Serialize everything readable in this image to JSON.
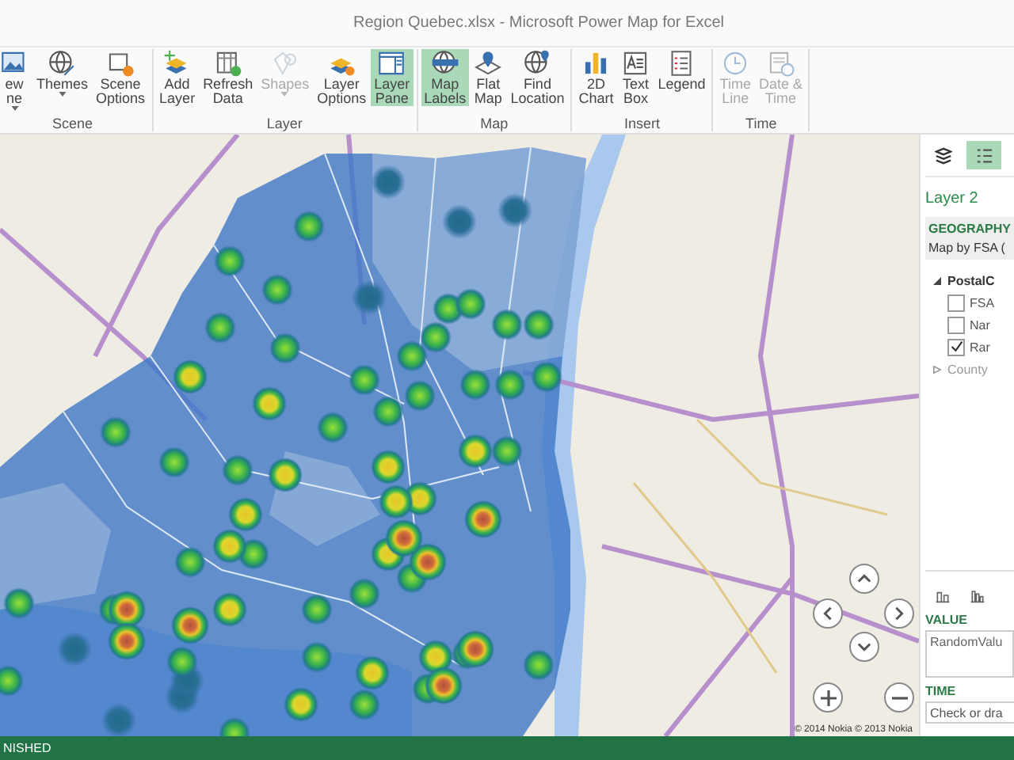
{
  "window": {
    "title": "Region Quebec.xlsx - Microsoft Power Map for Excel"
  },
  "ribbon": {
    "groups": [
      {
        "label": "Scene",
        "buttons": [
          {
            "label": "ew\nne",
            "dropdown": true,
            "selected": false,
            "disabled": false
          },
          {
            "label": "Themes",
            "dropdown": true,
            "selected": false,
            "disabled": false
          },
          {
            "label": "Scene\nOptions",
            "dropdown": false,
            "selected": false,
            "disabled": false
          }
        ]
      },
      {
        "label": "Layer",
        "buttons": [
          {
            "label": "Add\nLayer",
            "dropdown": false,
            "selected": false,
            "disabled": false
          },
          {
            "label": "Refresh\nData",
            "dropdown": false,
            "selected": false,
            "disabled": false
          },
          {
            "label": "Shapes",
            "dropdown": true,
            "selected": false,
            "disabled": true
          },
          {
            "label": "Layer\nOptions",
            "dropdown": false,
            "selected": false,
            "disabled": false
          },
          {
            "label": "Layer\nPane",
            "dropdown": false,
            "selected": true,
            "disabled": false
          }
        ]
      },
      {
        "label": "Map",
        "buttons": [
          {
            "label": "Map\nLabels",
            "dropdown": false,
            "selected": true,
            "disabled": false
          },
          {
            "label": "Flat\nMap",
            "dropdown": false,
            "selected": false,
            "disabled": false
          },
          {
            "label": "Find\nLocation",
            "dropdown": false,
            "selected": false,
            "disabled": false
          }
        ]
      },
      {
        "label": "Insert",
        "buttons": [
          {
            "label": "2D\nChart",
            "dropdown": false,
            "selected": false,
            "disabled": false
          },
          {
            "label": "Text\nBox",
            "dropdown": false,
            "selected": false,
            "disabled": false
          },
          {
            "label": "Legend",
            "dropdown": false,
            "selected": false,
            "disabled": false
          }
        ]
      },
      {
        "label": "Time",
        "buttons": [
          {
            "label": "Time\nLine",
            "dropdown": false,
            "selected": false,
            "disabled": true
          },
          {
            "label": "Date &\nTime",
            "dropdown": false,
            "selected": false,
            "disabled": true
          }
        ]
      }
    ]
  },
  "map": {
    "attribution": "© 2014 Nokia  © 2013 Nokia"
  },
  "pane": {
    "tabs": [
      {
        "selected": false
      },
      {
        "selected": true
      }
    ],
    "layer_name": "Layer 2",
    "geography": {
      "heading": "GEOGRAPHY",
      "mapping": "Map by FSA ("
    },
    "fields": [
      {
        "label": "PostalC",
        "expanded": true,
        "children": [
          {
            "label": "FSA",
            "checked": false
          },
          {
            "label": "Nar",
            "checked": false
          },
          {
            "label": "Rar",
            "checked": true
          }
        ]
      },
      {
        "label": "County",
        "expanded": false
      }
    ],
    "value": {
      "heading": "VALUE",
      "value": "RandomValu"
    },
    "time": {
      "heading": "TIME",
      "placeholder": "Check or dra"
    }
  },
  "status_bar": {
    "text": "NISHED"
  }
}
